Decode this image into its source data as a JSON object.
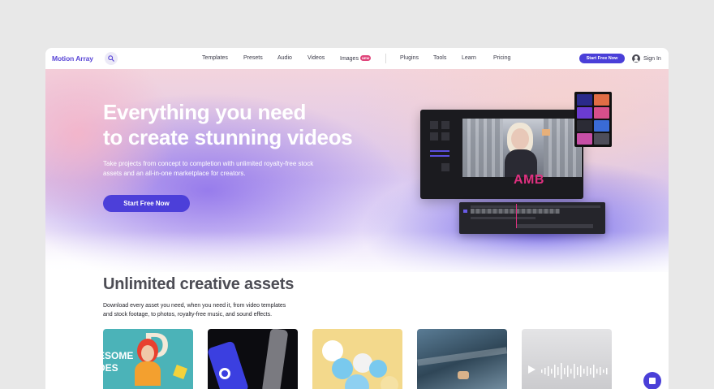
{
  "nav": {
    "logo": "Motion Array",
    "links": [
      {
        "label": "Templates"
      },
      {
        "label": "Presets"
      },
      {
        "label": "Audio"
      },
      {
        "label": "Videos"
      },
      {
        "label": "Images",
        "badge": "NEW"
      },
      {
        "label": "Plugins"
      },
      {
        "label": "Tools"
      },
      {
        "label": "Learn"
      },
      {
        "label": "Pricing"
      }
    ],
    "cta": "Start Free Now",
    "signin": "Sign In",
    "icons": {
      "search": "search-icon",
      "user": "user-icon"
    }
  },
  "hero": {
    "title_line1": "Everything you need",
    "title_line2": "to create stunning videos",
    "subtitle_line1": "Take projects from concept to completion with unlimited royalty-free stock",
    "subtitle_line2": "assets and an all-in-one marketplace for creators.",
    "cta": "Start Free Now",
    "editor_overlay_text": "AMB"
  },
  "assets": {
    "title": "Unlimited creative assets",
    "subtitle_line1": "Download every asset you need, when you need it, from video templates",
    "subtitle_line2": "and stock footage, to photos, royalty-free music, and sound effects.",
    "card1_text_line1": "ESOME",
    "card1_text_line2": "DES",
    "card1_letter": "D"
  },
  "colors": {
    "accent": "#4a3fd8",
    "brand_text": "#5a47d6",
    "badge": "#e0457b"
  }
}
